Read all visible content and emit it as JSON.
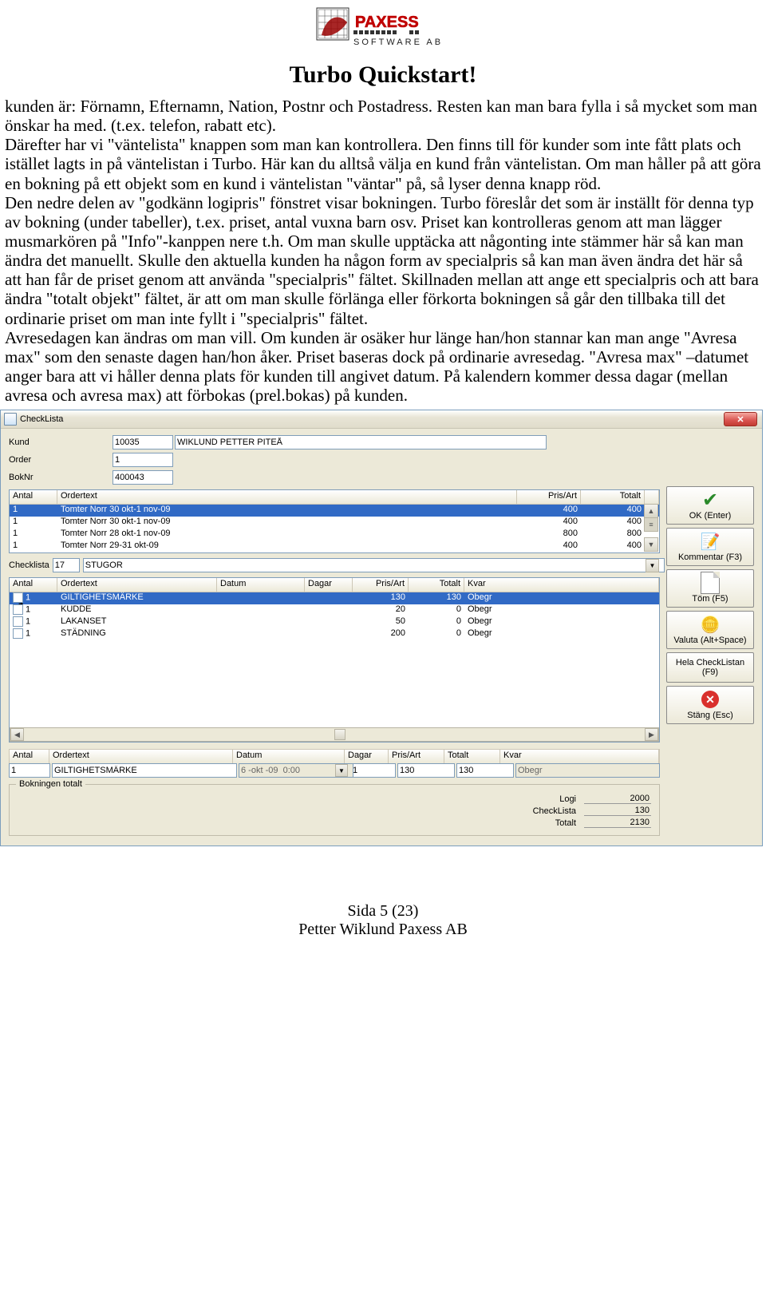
{
  "logo": {
    "top_word": "PAXESS",
    "bottom_word": "SOFTWARE AB"
  },
  "heading": "Turbo Quickstart!",
  "body_text": "kunden är: Förnamn, Efternamn, Nation, Postnr och Postadress. Resten kan man bara fylla i så mycket som man önskar ha med. (t.ex. telefon, rabatt etc).\nDärefter har vi \"väntelista\" knappen som man kan kontrollera. Den finns till för kunder som inte fått plats och istället lagts in på väntelistan i Turbo. Här kan du alltså välja en kund från väntelistan. Om man håller på att göra en bokning på ett objekt som en kund i väntelistan \"väntar\" på, så lyser denna knapp röd.\nDen nedre delen av \"godkänn logipris\" fönstret visar bokningen. Turbo föreslår det som är inställt för denna typ av bokning (under tabeller), t.ex. priset, antal vuxna barn osv. Priset kan kontrolleras genom att man lägger musmarkören på \"Info\"-kanppen nere t.h. Om man skulle upptäcka att någonting inte stämmer här så kan man ändra det manuellt. Skulle den aktuella kunden ha någon form av specialpris så kan man även ändra det här så att han får de priset genom att använda \"specialpris\" fältet. Skillnaden mellan att ange ett specialpris och att bara ändra \"totalt objekt\" fältet, är att om man skulle förlänga eller förkorta bokningen så går den tillbaka till det ordinarie priset om man inte fyllt i \"specialpris\" fältet.\nAvresedagen kan ändras om man vill. Om kunden är osäker hur länge han/hon stannar kan man ange \"Avresa max\" som den senaste dagen han/hon åker. Priset baseras dock på ordinarie avresedag. \"Avresa max\" –datumet anger bara att vi håller denna plats för kunden till angivet datum. På kalendern kommer dessa dagar (mellan avresa och avresa max) att förbokas (prel.bokas) på kunden.",
  "dialog": {
    "title": "CheckLista",
    "labels": {
      "kund": "Kund",
      "order": "Order",
      "boknr": "BokNr",
      "antal": "Antal",
      "ordertext": "Ordertext",
      "prisart": "Pris/Art",
      "totalt": "Totalt",
      "checklista": "Checklista",
      "datum": "Datum",
      "dagar": "Dagar",
      "kvar": "Kvar"
    },
    "kund_id": "10035",
    "kund_name": "WIKLUND PETTER PITEÅ",
    "order": "1",
    "boknr": "400043",
    "order_rows": [
      {
        "antal": "1",
        "text": "Tomter Norr  30 okt-1 nov-09",
        "pris": "400",
        "tot": "400",
        "sel": true
      },
      {
        "antal": "1",
        "text": "Tomter Norr  30 okt-1 nov-09",
        "pris": "400",
        "tot": "400"
      },
      {
        "antal": "1",
        "text": "Tomter Norr  28 okt-1 nov-09",
        "pris": "800",
        "tot": "800"
      },
      {
        "antal": "1",
        "text": "Tomter Norr  29-31 okt-09",
        "pris": "400",
        "tot": "400"
      }
    ],
    "checklista_id": "17",
    "checklista_name": "STUGOR",
    "check_rows": [
      {
        "chk": true,
        "antal": "1",
        "text": "GILTIGHETSMÄRKE",
        "pris": "130",
        "tot": "130",
        "kvar": "Obegr",
        "sel": true
      },
      {
        "chk": false,
        "antal": "1",
        "text": "KUDDE",
        "pris": "20",
        "tot": "0",
        "kvar": "Obegr"
      },
      {
        "chk": false,
        "antal": "1",
        "text": "LAKANSET",
        "pris": "50",
        "tot": "0",
        "kvar": "Obegr"
      },
      {
        "chk": false,
        "antal": "1",
        "text": "STÄDNING",
        "pris": "200",
        "tot": "0",
        "kvar": "Obegr"
      }
    ],
    "bottom": {
      "antal": "1",
      "text": "GILTIGHETSMÄRKE",
      "datum": "6 -okt -09  0:00",
      "dagar": "1",
      "pris": "130",
      "tot": "130",
      "kvar": "Obegr"
    },
    "summary": {
      "title": "Bokningen totalt",
      "logi_label": "Logi",
      "logi": "2000",
      "check_label": "CheckLista",
      "check": "130",
      "tot_label": "Totalt",
      "tot": "2130"
    },
    "buttons": {
      "ok": "OK (Enter)",
      "kommentar": "Kommentar (F3)",
      "tom": "Töm (F5)",
      "valuta": "Valuta (Alt+Space)",
      "hela": "Hela CheckListan (F9)",
      "stang": "Stäng (Esc)"
    }
  },
  "footer": {
    "line1": "Sida 5 (23)",
    "line2": "Petter Wiklund Paxess AB"
  }
}
